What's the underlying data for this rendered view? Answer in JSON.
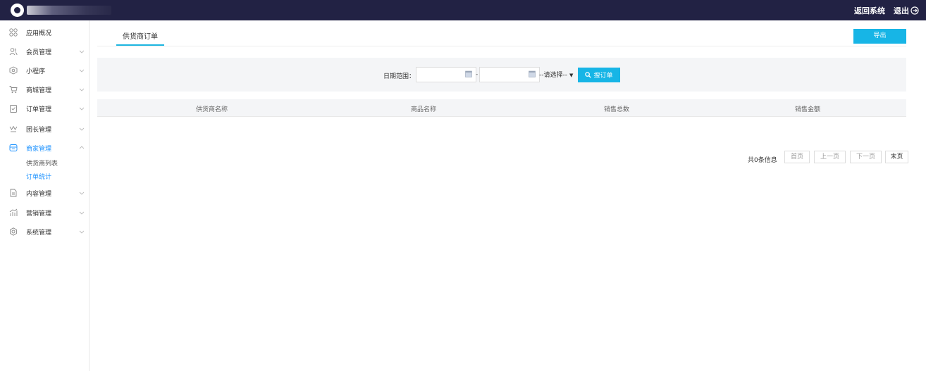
{
  "header": {
    "return_label": "返回系统",
    "logout_label": "退出",
    "bg_color": "#222244"
  },
  "sidebar": {
    "items": [
      {
        "label": "应用概况",
        "icon": "grid-icon",
        "expandable": false
      },
      {
        "label": "会员管理",
        "icon": "users-icon",
        "expandable": true
      },
      {
        "label": "小程序",
        "icon": "miniprogram-icon",
        "expandable": true
      },
      {
        "label": "商城管理",
        "icon": "cart-icon",
        "expandable": true
      },
      {
        "label": "订单管理",
        "icon": "order-icon",
        "expandable": true
      },
      {
        "label": "团长管理",
        "icon": "crown-icon",
        "expandable": true
      },
      {
        "label": "商家管理",
        "icon": "store-icon",
        "expandable": true,
        "expanded": true,
        "children": [
          {
            "label": "供货商列表",
            "active": false
          },
          {
            "label": "订单统计",
            "active": true
          }
        ]
      },
      {
        "label": "内容管理",
        "icon": "document-icon",
        "expandable": true
      },
      {
        "label": "营销管理",
        "icon": "chart-icon",
        "expandable": true
      },
      {
        "label": "系统管理",
        "icon": "settings-icon",
        "expandable": true
      }
    ]
  },
  "main": {
    "tab_label": "供货商订单",
    "export_label": "导出",
    "filter": {
      "date_range_label": "日期范围：",
      "separator": "-",
      "select_value": "--请选择--",
      "search_label": "搜订单"
    },
    "table": {
      "columns": [
        "供货商名称",
        "商品名称",
        "销售总数",
        "销售金额"
      ],
      "rows": []
    },
    "pagination": {
      "total_text": "共0条信息",
      "first": "首页",
      "prev": "上一页",
      "next": "下一页",
      "last": "末页"
    }
  },
  "colors": {
    "accent": "#17b5e6",
    "active_link": "#1890ff"
  }
}
